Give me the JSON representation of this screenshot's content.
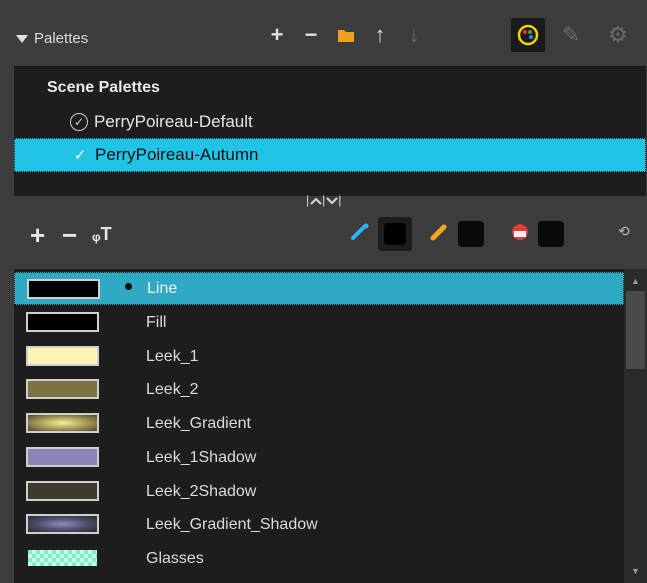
{
  "toolbar": {
    "title": "Palettes",
    "icons": [
      {
        "name": "add-palette-icon",
        "glyph": "+"
      },
      {
        "name": "remove-palette-icon",
        "glyph": "−"
      },
      {
        "name": "import-palette-icon",
        "glyph": "▰"
      },
      {
        "name": "move-up-icon",
        "glyph": "↑"
      },
      {
        "name": "move-down-icon",
        "glyph": "↓"
      },
      {
        "name": "palette-lock-icon",
        "glyph": "🎨"
      },
      {
        "name": "brush-pencil-icon",
        "glyph": "✎"
      },
      {
        "name": "palette-disabled-icon",
        "glyph": "⚙"
      }
    ]
  },
  "palettes": {
    "header": "Scene Palettes",
    "items": [
      {
        "label": "PerryPoireau-Default",
        "selected": false
      },
      {
        "label": "PerryPoireau-Autumn",
        "selected": true
      }
    ]
  },
  "splitter": {
    "label": "|^|v|"
  },
  "swatch_toolbar": {
    "add": "+",
    "remove": "−",
    "add_texture": "ᵩT",
    "tools": [
      {
        "name": "eyedropper-icon",
        "color": "#2db6ff"
      },
      {
        "name": "pencil-icon",
        "color": "#f5a623"
      },
      {
        "name": "paint-bucket-icon",
        "color": "#e23b3b"
      }
    ],
    "link_icon": "⟲"
  },
  "colors": [
    {
      "name": "Line",
      "swatch": "#000000",
      "selected": true
    },
    {
      "name": "Fill",
      "swatch": "#000000",
      "selected": false
    },
    {
      "name": "Leek_1",
      "swatch": "#fdf6b4",
      "selected": false
    },
    {
      "name": "Leek_2",
      "swatch": "#7a7342",
      "selected": false
    },
    {
      "name": "Leek_Gradient",
      "swatch": "gradient-gold",
      "selected": false
    },
    {
      "name": "Leek_1Shadow",
      "swatch": "#8a86b8",
      "selected": false
    },
    {
      "name": "Leek_2Shadow",
      "swatch": "#3e3b2e",
      "selected": false
    },
    {
      "name": "Leek_Gradient_Shadow",
      "swatch": "gradient-blue",
      "selected": false
    },
    {
      "name": "Glasses",
      "swatch": "checker-green",
      "selected": false
    }
  ],
  "accent_colors": {
    "selection_blue": "#21c4e6",
    "row_selection": "#30a9c5",
    "panel_bg": "#1d1d1d"
  }
}
